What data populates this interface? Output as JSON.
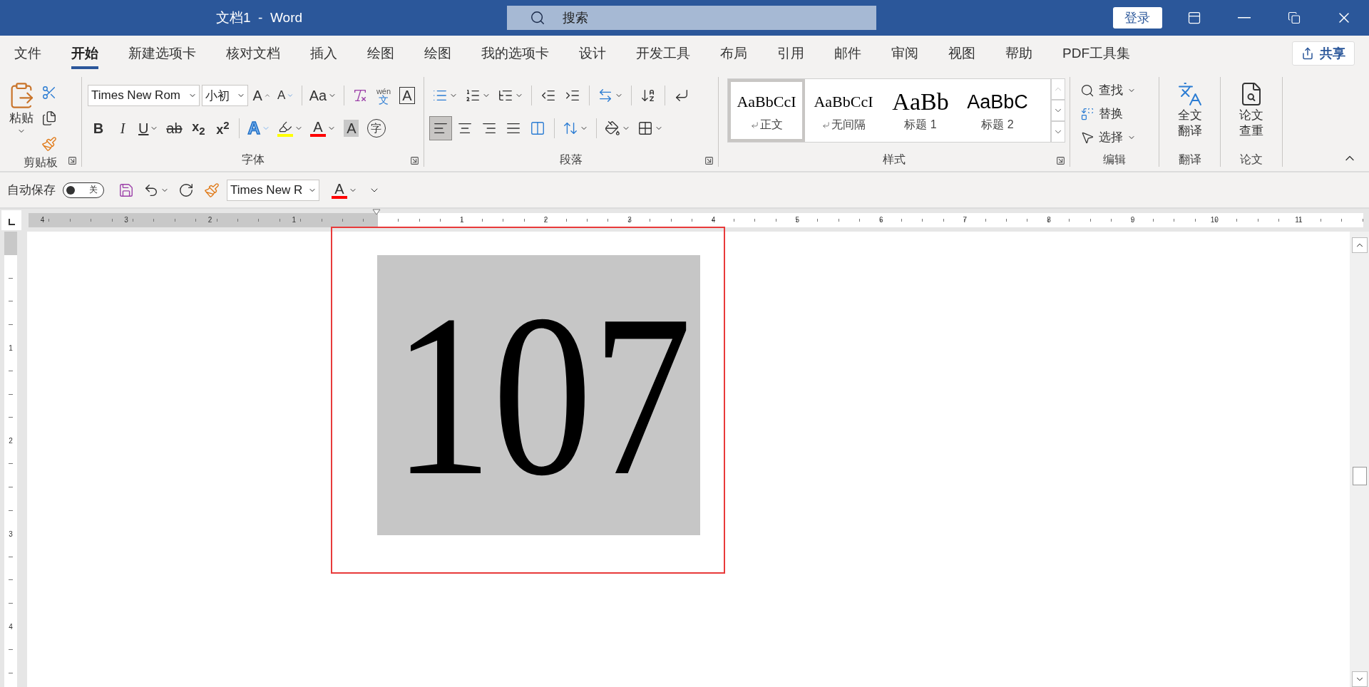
{
  "window": {
    "title": "文档1  -  Word",
    "search_placeholder": "搜索",
    "sign_in": "登录"
  },
  "tabs": [
    {
      "label": "文件",
      "selected": false
    },
    {
      "label": "开始",
      "selected": true
    },
    {
      "label": "新建选项卡",
      "selected": false
    },
    {
      "label": "核对文档",
      "selected": false
    },
    {
      "label": "插入",
      "selected": false
    },
    {
      "label": "绘图",
      "selected": false
    },
    {
      "label": "绘图",
      "selected": false
    },
    {
      "label": "我的选项卡",
      "selected": false
    },
    {
      "label": "设计",
      "selected": false
    },
    {
      "label": "开发工具",
      "selected": false
    },
    {
      "label": "布局",
      "selected": false
    },
    {
      "label": "引用",
      "selected": false
    },
    {
      "label": "邮件",
      "selected": false
    },
    {
      "label": "审阅",
      "selected": false
    },
    {
      "label": "视图",
      "selected": false
    },
    {
      "label": "帮助",
      "selected": false
    },
    {
      "label": "PDF工具集",
      "selected": false
    }
  ],
  "share": "共享",
  "clipboard": {
    "paste": "粘贴",
    "label": "剪贴板"
  },
  "font": {
    "name": "Times New Rom",
    "size": "小初",
    "grow": "A",
    "shrink": "A",
    "change_case": "Aa",
    "phonetic_top": "wén",
    "phonetic_bottom": "文",
    "char_border": "A",
    "bold": "B",
    "italic": "I",
    "underline": "U",
    "strike": "ab",
    "subscript": "x$_{2}$",
    "superscript": "x$^{2}$",
    "text_effects": "A",
    "font_color": "A",
    "shading": "A",
    "enclose": "字",
    "label": "字体"
  },
  "paragraph": {
    "label": "段落",
    "alignments": [
      {
        "kind": "left",
        "selected": true
      },
      {
        "kind": "center",
        "selected": false
      },
      {
        "kind": "right",
        "selected": false
      },
      {
        "kind": "justify",
        "selected": false
      },
      {
        "kind": "distributed",
        "selected": false
      }
    ]
  },
  "styles": {
    "label": "样式",
    "items": [
      {
        "kind": "body",
        "sample": "AaBbCcI",
        "name": "正文",
        "selected": true
      },
      {
        "kind": "body",
        "sample": "AaBbCcI",
        "name": "无间隔",
        "selected": false
      },
      {
        "kind": "heading1",
        "sample": "AaBb",
        "name": "标题 1",
        "selected": false
      },
      {
        "kind": "heading2",
        "sample": "AaBbC",
        "name": "标题 2",
        "selected": false
      }
    ]
  },
  "editing": {
    "label": "编辑",
    "find": "查找",
    "replace": "替换",
    "select": "选择"
  },
  "translate": {
    "label": "翻译",
    "button": [
      "全文",
      "翻译"
    ]
  },
  "paper": {
    "label": "论文",
    "button": [
      "论文",
      "查重"
    ]
  },
  "quick_access": {
    "autosave": "自动保存",
    "autosave_on": false,
    "toggle_text": "关",
    "font": "Times New R",
    "font_color": "A"
  },
  "ruler": {
    "left_numbers": [
      "4",
      "3",
      "2",
      "1"
    ],
    "right_numbers": [
      "1",
      "2",
      "3",
      "4",
      "5",
      "6",
      "7",
      "8",
      "9",
      "10",
      "11"
    ],
    "vertical_numbers": [
      "1",
      "2",
      "3",
      "4"
    ]
  },
  "document": {
    "text": "107"
  }
}
